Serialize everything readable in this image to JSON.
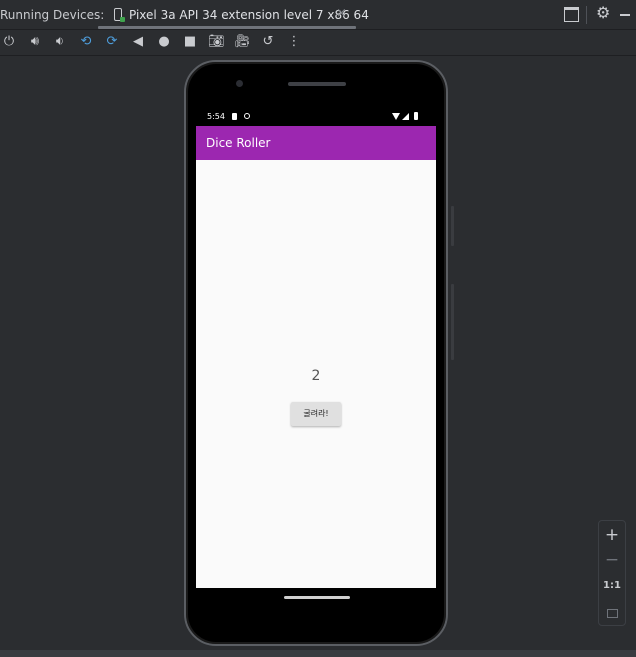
{
  "header": {
    "title": "Running Devices:",
    "device_tab": "Pixel 3a API 34 extension level 7 x86 64",
    "tab_close": "×"
  },
  "device": {
    "status_time": "5:54",
    "app_title": "Dice Roller",
    "result_text": "2",
    "roll_button_label": "굴려라!"
  },
  "zoom": {
    "zoom_in": "+",
    "zoom_out": "−",
    "actual_size": "1:1"
  },
  "colors": {
    "app_bar": "#9c27b0",
    "ide_background": "#2b2d30"
  }
}
